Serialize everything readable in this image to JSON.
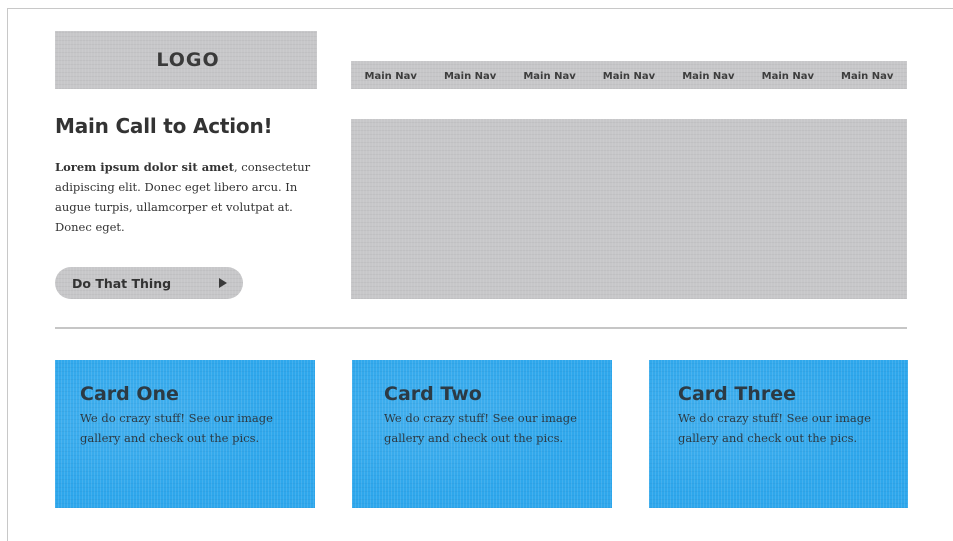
{
  "header": {
    "logo_text": "LOGO",
    "nav_items": [
      "Main Nav",
      "Main Nav",
      "Main Nav",
      "Main Nav",
      "Main Nav",
      "Main Nav",
      "Main Nav"
    ]
  },
  "cta": {
    "heading": "Main Call to Action!",
    "body_bold": "Lorem ipsum dolor sit amet",
    "body_rest": ", consectetur adipiscing elit. Donec eget libero arcu. In augue turpis, ullamcorper et volutpat at. Donec eget.",
    "button_label": "Do That Thing",
    "button_icon": "play-icon"
  },
  "cards": [
    {
      "title": "Card One",
      "text": "We do crazy stuff! See our image gallery and check out the pics."
    },
    {
      "title": "Card Two",
      "text": "We do crazy stuff! See our image gallery and check out the pics."
    },
    {
      "title": "Card Three",
      "text": "We do crazy stuff! See our image gallery and check out the pics."
    }
  ],
  "colors": {
    "placeholder_gray": "#c7c7c9",
    "card_blue": "#2ea7ec",
    "text_dark": "#333333"
  }
}
